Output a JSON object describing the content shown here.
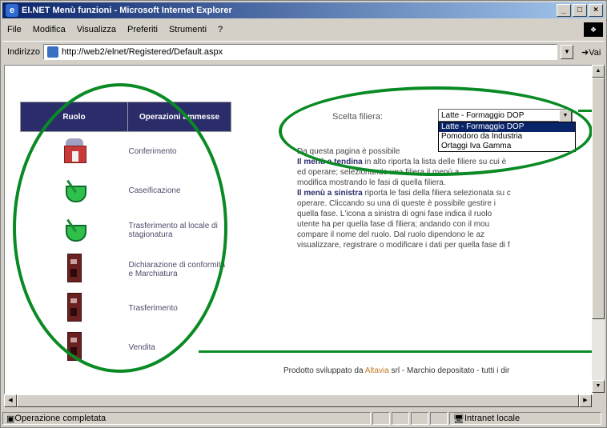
{
  "window": {
    "title": "EI.NET Menù funzioni - Microsoft Internet Explorer",
    "buttons": [
      "_",
      "□",
      "×"
    ]
  },
  "menubar": {
    "items": [
      "File",
      "Modifica",
      "Visualizza",
      "Preferiti",
      "Strumenti",
      "?"
    ]
  },
  "address": {
    "label": "Indirizzo",
    "url": "http://web2/elnet/Registered/Default.aspx",
    "go_label": "Vai"
  },
  "table": {
    "headers": [
      "Ruolo",
      "Operazioni ammesse"
    ],
    "rows": [
      {
        "icon": "barn-icon",
        "label": "Conferimento"
      },
      {
        "icon": "bowl-icon",
        "label": "Caseificazione"
      },
      {
        "icon": "bowl-icon",
        "label": "Trasferimento al locale di stagionatura"
      },
      {
        "icon": "tower-icon",
        "label": "Dichiarazione di conformità e Marchiatura"
      },
      {
        "icon": "tower-icon",
        "label": "Trasferimento"
      },
      {
        "icon": "tower-icon",
        "label": "Vendita"
      }
    ]
  },
  "filter": {
    "label": "Scelta filiera:",
    "selected": "Latte - Formaggio DOP",
    "options": [
      "Latte - Formaggio DOP",
      "Pomodoro da Industria",
      "Ortaggi Iva Gamma"
    ]
  },
  "description": {
    "lines": [
      [
        "Da questa pagina è possibile",
        ""
      ],
      [
        "",
        "Il menù a tendina",
        " in alto riporta la lista delle filiere su cui è"
      ],
      [
        "ed operare; selezionando una filiera il menù a"
      ],
      [
        "modifica mostrando le fasi di quella filiera."
      ],
      [
        "",
        "Il menù a sinistra",
        " riporta le fasi della filiera selezionata su c"
      ],
      [
        "operare. Cliccando su una di queste è possibile gestire i"
      ],
      [
        "quella fase. L'icona a sinistra di ogni fase indica il ruolo"
      ],
      [
        "utente ha per quella fase di filiera; andando con il mou"
      ],
      [
        "compare il nome del ruolo. Dal ruolo dipendono le az"
      ],
      [
        "visualizzare, registrare o modificare i dati per quella fase di f"
      ]
    ]
  },
  "footer": {
    "text_prefix": "Prodotto sviluppato da ",
    "brand": "Altavia",
    "text_suffix": " srl - Marchio depositato - tutti i dir"
  },
  "statusbar": {
    "status": "Operazione completata",
    "zone": "Intranet locale"
  },
  "colors": {
    "highlight_ellipse": "#0a8a24",
    "table_header": "#2b2d6b"
  }
}
